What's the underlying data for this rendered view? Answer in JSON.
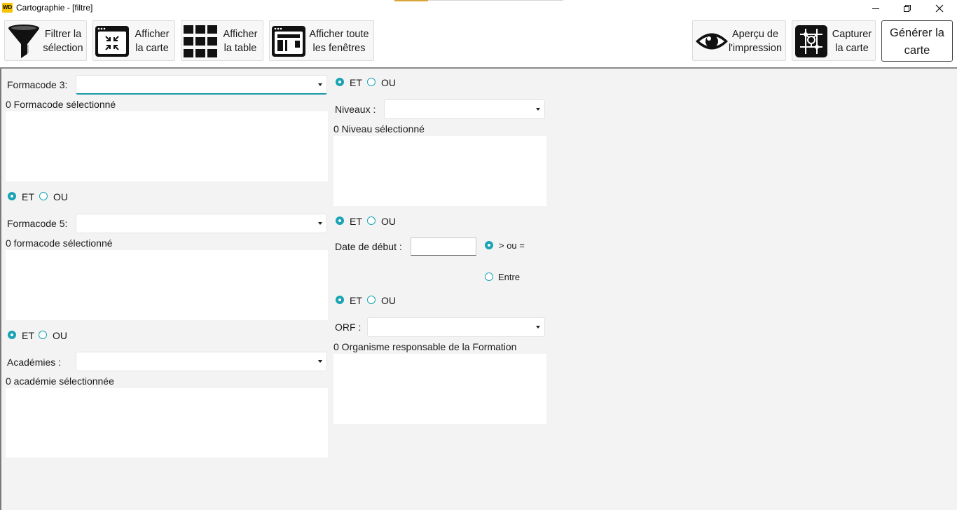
{
  "window": {
    "title": "Cartographie - [filtre]",
    "logo_text": "WD"
  },
  "toolbar": {
    "filtrer": {
      "line1": "Filtrer la",
      "line2": "sélection",
      "icon": "funnel-icon"
    },
    "afficher_carte": {
      "line1": "Afficher",
      "line2": "la carte",
      "icon": "collapse-window-icon"
    },
    "afficher_table": {
      "line1": "Afficher",
      "line2": "la table",
      "icon": "grid-icon"
    },
    "afficher_fenetres": {
      "line1": "Afficher toute",
      "line2": "les fenêtres",
      "icon": "windows-layout-icon"
    },
    "apercu": {
      "line1": "Aperçu de",
      "line2": "l'impression",
      "icon": "eye-icon"
    },
    "capturer": {
      "line1": "Capturer",
      "line2": "la carte",
      "icon": "map-capture-icon"
    },
    "generer": {
      "line1": "Générer la",
      "line2": "carte"
    }
  },
  "logic": {
    "et": "ET",
    "ou": "OU"
  },
  "left": {
    "formacode3": {
      "label": "Formacode 3:",
      "value": "",
      "count": "0 Formacode sélectionné"
    },
    "formacode5": {
      "label": "Formacode 5:",
      "value": "",
      "count": "0 formacode sélectionné"
    },
    "academies": {
      "label": "Académies :",
      "value": "",
      "count": "0 académie sélectionnée"
    }
  },
  "right": {
    "niveaux": {
      "label": "Niveaux :",
      "value": "",
      "count": "0 Niveau sélectionné"
    },
    "date": {
      "label": "Date de début :",
      "value": "",
      "opt_gte": "> ou =",
      "opt_between": "Entre"
    },
    "orf": {
      "label": "ORF :",
      "value": "",
      "count": "0 Organisme responsable de la Formation"
    }
  },
  "colors": {
    "accent": "#1aa3b5",
    "logo": "#f6c400"
  }
}
